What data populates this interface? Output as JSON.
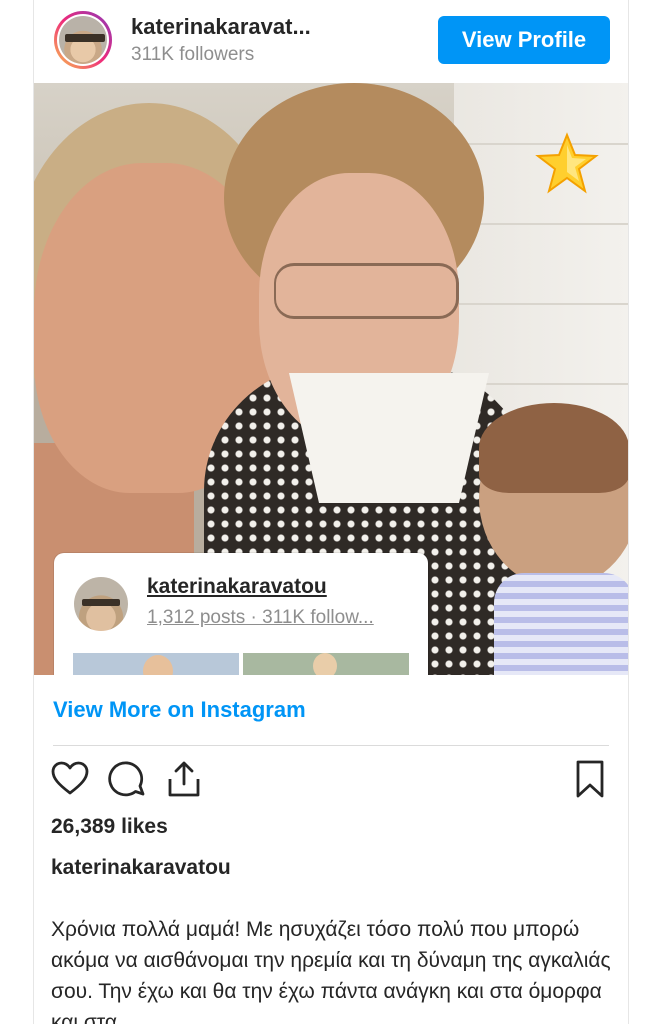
{
  "header": {
    "username": "katerinakaravat...",
    "followers": "311K followers",
    "view_profile_label": "View Profile"
  },
  "embed": {
    "username": "katerinakaravatou",
    "stats": "1,312 posts · 311K follow..."
  },
  "view_more_label": "View More on Instagram",
  "actions": {
    "icons": [
      "heart-icon",
      "comment-icon",
      "share-icon",
      "bookmark-icon"
    ]
  },
  "likes": "26,389 likes",
  "post_owner": "katerinakaravatou",
  "caption": "Χρόνια πολλά μαμά! Με ησυχάζει τόσο πολύ που μπορώ ακόμα να αισθάνομαι την ηρεμία και τη δύναμη της αγκαλιάς σου. Την έχω και θα την έχω πάντα ανάγκη και στα όμορφα και στα",
  "colors": {
    "accent": "#0095f6",
    "text": "#262626",
    "secondary_text": "#8e8e8e"
  }
}
